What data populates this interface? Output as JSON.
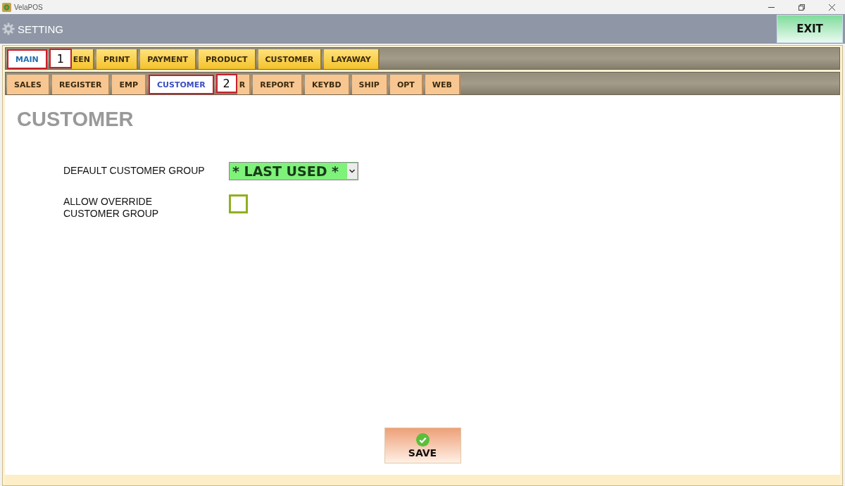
{
  "window": {
    "title": "VelaPOS"
  },
  "header": {
    "title": "SETTING",
    "exit_button": "EXIT"
  },
  "main_tabs": [
    {
      "label": "MAIN",
      "selected": true
    },
    {
      "label": "EEN",
      "selected": false
    },
    {
      "label": "PRINT",
      "selected": false
    },
    {
      "label": "PAYMENT",
      "selected": false
    },
    {
      "label": "PRODUCT",
      "selected": false
    },
    {
      "label": "CUSTOMER",
      "selected": false
    },
    {
      "label": "LAYAWAY",
      "selected": false
    }
  ],
  "sub_tabs": [
    {
      "label": "SALES",
      "selected": false
    },
    {
      "label": "REGISTER",
      "selected": false
    },
    {
      "label": "EMP",
      "selected": false
    },
    {
      "label": "CUSTOMER",
      "selected": true
    },
    {
      "label": "R",
      "selected": false
    },
    {
      "label": "REPORT",
      "selected": false
    },
    {
      "label": "KEYBD",
      "selected": false
    },
    {
      "label": "SHIP",
      "selected": false
    },
    {
      "label": "OPT",
      "selected": false
    },
    {
      "label": "WEB",
      "selected": false
    }
  ],
  "callouts": [
    {
      "label": "1"
    },
    {
      "label": "2"
    }
  ],
  "page": {
    "heading": "CUSTOMER",
    "settings": [
      {
        "kind": "dropdown",
        "label": "DEFAULT CUSTOMER GROUP",
        "value": "* LAST USED *"
      },
      {
        "kind": "checkbox",
        "label": "ALLOW OVERRIDE\nCUSTOMER GROUP",
        "checked": false
      }
    ],
    "save_button": "SAVE"
  }
}
